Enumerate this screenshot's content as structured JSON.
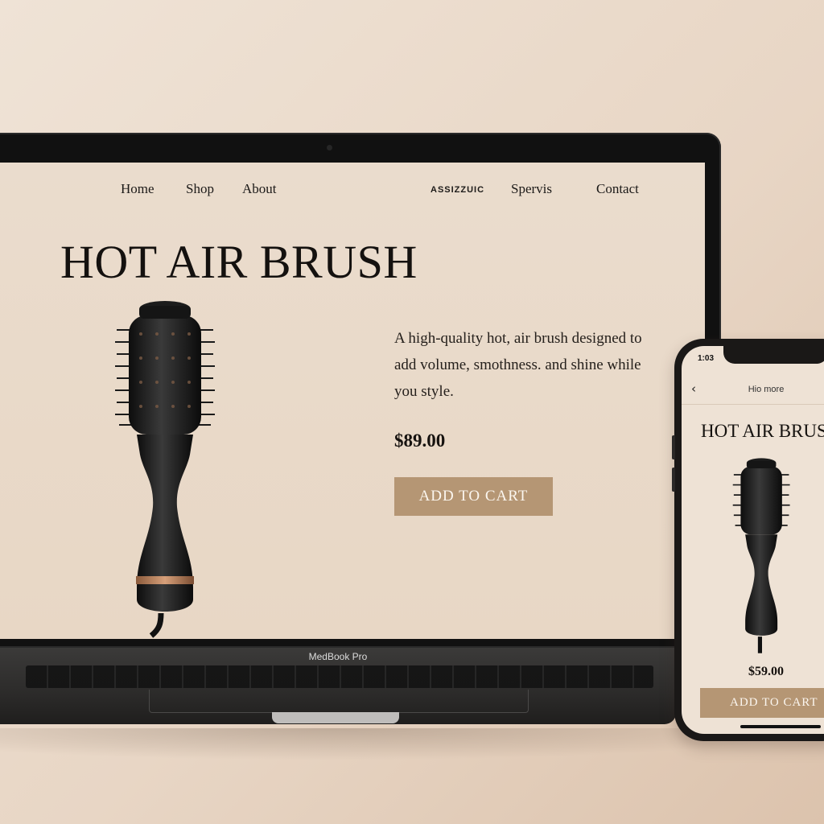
{
  "laptop": {
    "model_label": "MedBook Pro",
    "nav": {
      "home": "Home",
      "shop": "Shop",
      "about": "About",
      "brand": "ASSIZZUIC",
      "services": "Spervis",
      "contact": "Contact"
    },
    "hero_title": "HOT AIR BRUSH",
    "description": "A high-quality hot, air brush designed to add volume, smothness. and shine while you style.",
    "price": "$89.00",
    "cta": "ADD TO CART"
  },
  "phone": {
    "status_time": "1:03",
    "header": "Hio more",
    "title": "HOT AIR BRUSH",
    "price": "$59.00",
    "cta": "ADD TO CART"
  },
  "icons": {
    "back": "chevron-left-icon"
  },
  "colors": {
    "accent": "#b59674",
    "page_background": "#e8d7c5",
    "text": "#14110f"
  }
}
